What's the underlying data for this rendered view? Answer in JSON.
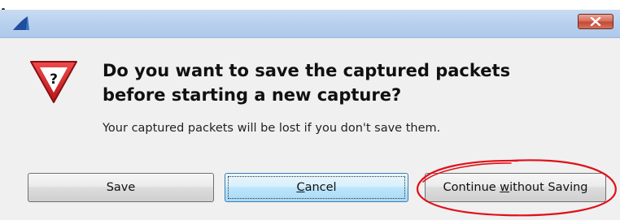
{
  "dialog": {
    "heading_line1": "Do you want to save the captured packets",
    "heading_line2": "before starting a new capture?",
    "message": "Your captured packets will be lost if you don't save them."
  },
  "titlebar": {
    "close_glyph": "✕"
  },
  "icon": {
    "warning_glyph": "?"
  },
  "buttons": {
    "save": {
      "label": "Save"
    },
    "cancel": {
      "pre": "",
      "accel": "C",
      "post": "ancel"
    },
    "continue": {
      "pre": "Continue ",
      "accel": "w",
      "post": "ithout Saving"
    }
  },
  "colors": {
    "title_bar": "#b9d1ee",
    "close_button": "#c44a36",
    "warning_icon": "#d4242a",
    "annotation_circle": "#e0101a"
  },
  "icons": {
    "app": "wireshark-fin-icon",
    "close": "close-icon",
    "warning": "warning-question-icon"
  }
}
